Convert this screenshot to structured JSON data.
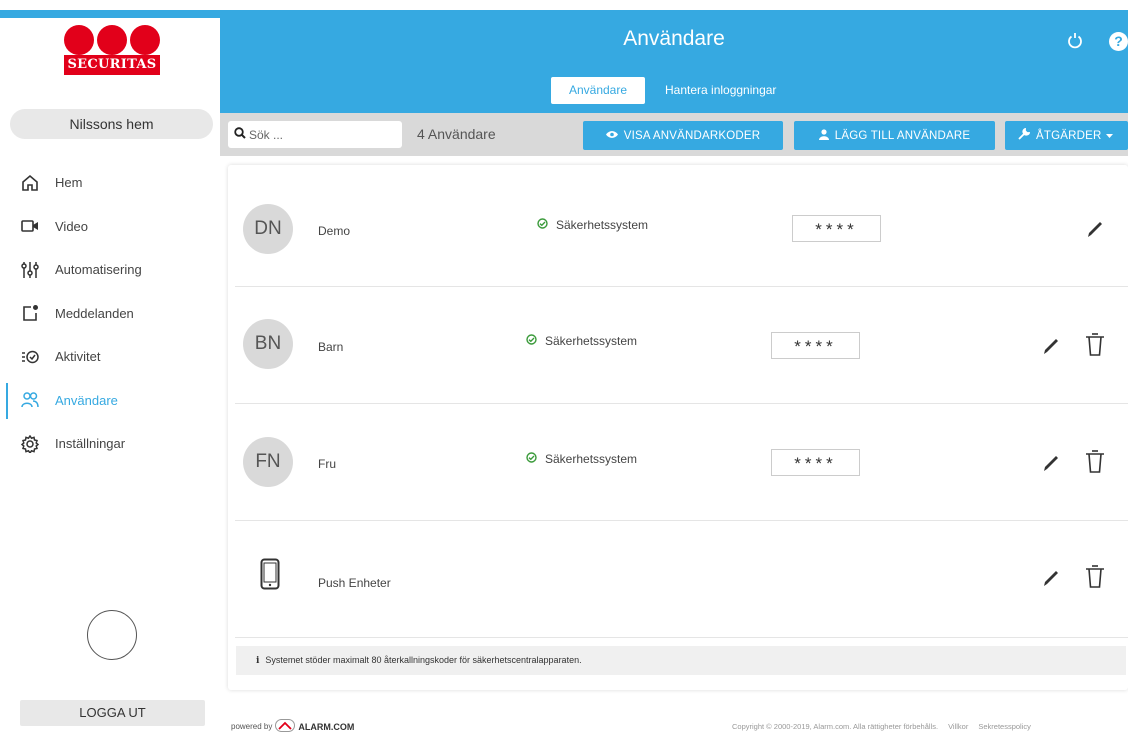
{
  "sidebar": {
    "logo_text": "SECURITAS",
    "home_name": "Nilssons hem",
    "items": [
      {
        "label": "Hem",
        "icon": "home-icon"
      },
      {
        "label": "Video",
        "icon": "video-icon"
      },
      {
        "label": "Automatisering",
        "icon": "sliders-icon"
      },
      {
        "label": "Meddelanden",
        "icon": "notification-icon"
      },
      {
        "label": "Aktivitet",
        "icon": "activity-icon"
      },
      {
        "label": "Användare",
        "icon": "users-icon",
        "active": true
      },
      {
        "label": "Inställningar",
        "icon": "gear-icon"
      }
    ],
    "logout_label": "LOGGA UT"
  },
  "header": {
    "title": "Användare",
    "tabs": [
      {
        "label": "Användare",
        "active": true
      },
      {
        "label": "Hantera inloggningar",
        "active": false
      }
    ],
    "help_symbol": "?"
  },
  "toolbar": {
    "search_placeholder": "Sök ...",
    "count": "4 Användare",
    "show_codes": "VISA ANVÄNDARKODER",
    "add_user": "LÄGG TILL ANVÄNDARE",
    "actions": "ÅTGÄRDER"
  },
  "users": [
    {
      "initials": "DN",
      "name": "Demo",
      "system": "Säkerhetssystem",
      "code": "****"
    },
    {
      "initials": "BN",
      "name": "Barn",
      "system": "Säkerhetssystem",
      "code": "****"
    },
    {
      "initials": "FN",
      "name": "Fru",
      "system": "Säkerhetssystem",
      "code": "****"
    }
  ],
  "push": {
    "name": "Push Enheter"
  },
  "info": {
    "text": "Systemet stöder maximalt 80 återkallningskoder för säkerhetscentralapparaten."
  },
  "footer": {
    "powered_by": "powered by",
    "brand": "ALARM.COM",
    "copyright": "Copyright © 2000-2019, Alarm.com. Alla rättigheter förbehålls.",
    "terms": "Villkor",
    "privacy": "Sekretesspolicy"
  },
  "colors": {
    "accent": "#36a9e1",
    "brand_red": "#e2001a",
    "success": "#3a9a3a"
  }
}
